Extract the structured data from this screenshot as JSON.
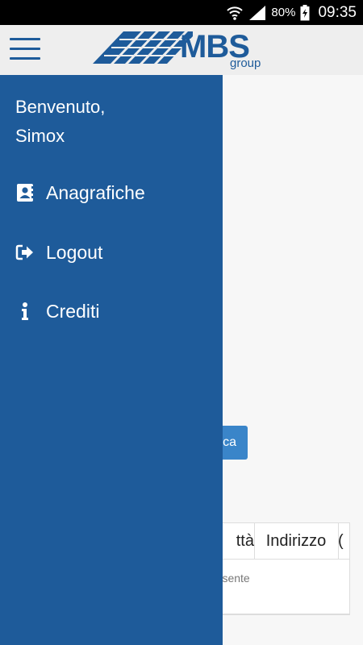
{
  "status_bar": {
    "battery": "80%",
    "time": "09:35"
  },
  "app_bar": {
    "logo_text": "MBS",
    "logo_sub": "group"
  },
  "background": {
    "search_button_label": "ca",
    "table_headers": [
      "ttà",
      "Indirizzo",
      "("
    ],
    "empty_message": "resente"
  },
  "drawer": {
    "welcome_line1": "Benvenuto,",
    "user_name": "Simox",
    "items": [
      {
        "label": "Anagrafiche",
        "icon": "address-book-icon"
      },
      {
        "label": "Logout",
        "icon": "sign-out-icon"
      },
      {
        "label": "Crediti",
        "icon": "info-icon"
      }
    ]
  },
  "colors": {
    "brand": "#1e5b9a",
    "accent": "#3a85c9"
  }
}
